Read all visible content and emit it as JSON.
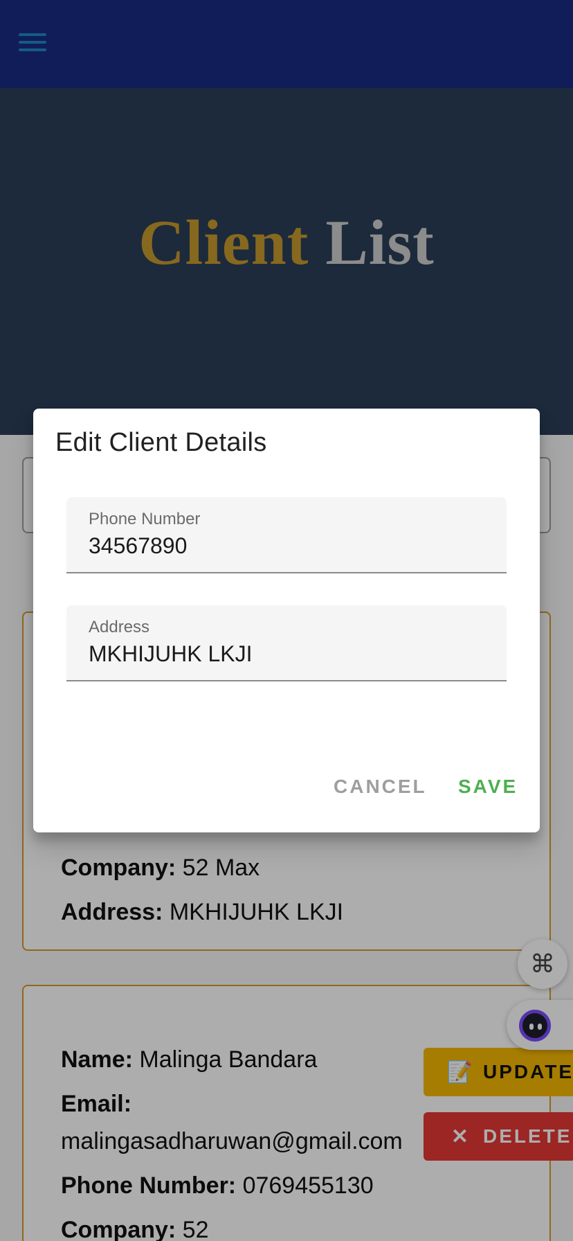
{
  "hero": {
    "title_part1": "Client",
    "title_part2": "List"
  },
  "card1": {
    "company_label": "Company:",
    "company_value": " 52 Max",
    "address_label": "Address:",
    "address_value": " MKHIJUHK LKJI"
  },
  "card2": {
    "name_label": "Name:",
    "name_value": " Malinga Bandara",
    "email_label": "Email:",
    "email_value": "malingasadharuwan@gmail.com",
    "phone_label": "Phone Number:",
    "phone_value": " 0769455130",
    "company_label": "Company:",
    "company_value": " 52"
  },
  "actions": {
    "update_label": "UPDATE",
    "delete_label": "DELETE"
  },
  "dialog": {
    "title": "Edit Client Details",
    "phone_label": "Phone Number",
    "phone_value": "34567890",
    "address_label": "Address",
    "address_value": "MKHIJUHK LKJI",
    "cancel_label": "CANCEL",
    "save_label": "SAVE"
  },
  "icons": {
    "menu": "hamburger-menu-icon",
    "update": "memo-edit-icon",
    "delete": "close-x-icon",
    "command": "command-key-icon",
    "assistant": "assistant-bot-icon"
  },
  "colors": {
    "appbar": "#1a2c82",
    "hero": "#2a3e57",
    "title_gold": "#c89a2e",
    "title_grey": "#cfcfcf",
    "card_border": "#d59a2a",
    "save": "#4caf50",
    "update": "#f5b800",
    "delete": "#e53935"
  }
}
